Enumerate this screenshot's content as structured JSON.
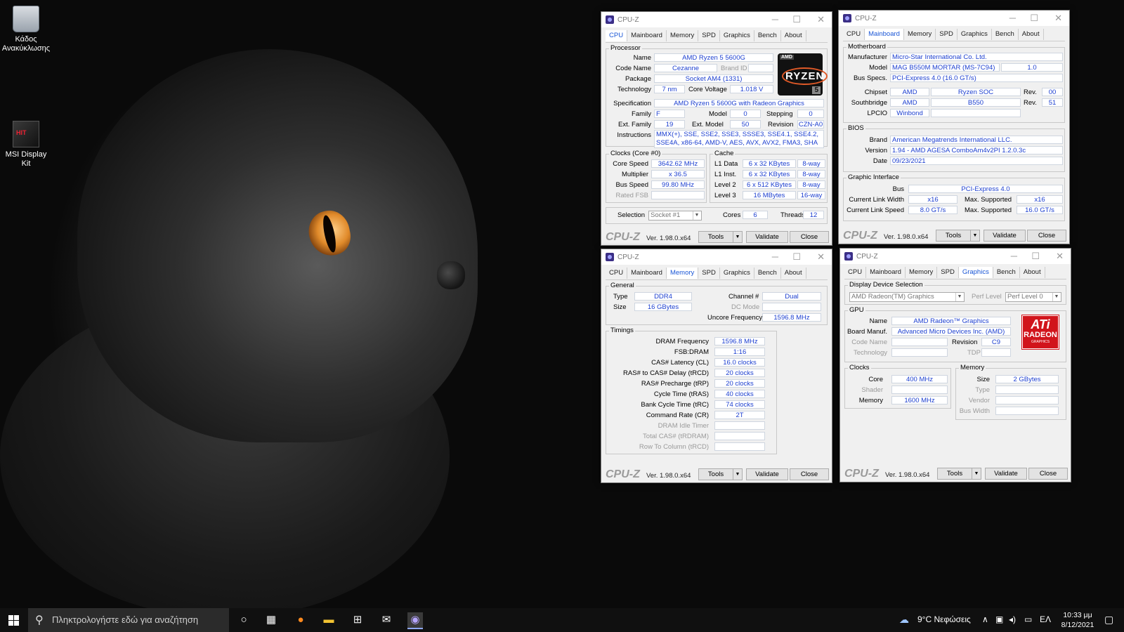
{
  "desktop": {
    "icons": [
      {
        "label": "Κάδος Ανακύκλωσης"
      },
      {
        "label": "MSI Display Kit",
        "badge": "HIT"
      }
    ]
  },
  "taskbar": {
    "search_placeholder": "Πληκτρολογήστε εδώ για αναζήτηση",
    "weather": "9°C  Νεφώσεις",
    "lang": "ΕΛ",
    "time": "10:33 μμ",
    "date": "8/12/2021"
  },
  "common": {
    "app_title": "CPU-Z",
    "tabs": [
      "CPU",
      "Mainboard",
      "Memory",
      "SPD",
      "Graphics",
      "Bench",
      "About"
    ],
    "brand": "CPU-Z",
    "version": "Ver. 1.98.0.x64",
    "tools": "Tools",
    "validate": "Validate",
    "close": "Close",
    "dropdown_arrow": "▼"
  },
  "cpu": {
    "processor_group": "Processor",
    "name_label": "Name",
    "name": "AMD Ryzen 5 5600G",
    "codename_label": "Code Name",
    "codename": "Cezanne",
    "brandid_label": "Brand ID",
    "package_label": "Package",
    "package": "Socket AM4 (1331)",
    "technology_label": "Technology",
    "technology": "7 nm",
    "corevoltage_label": "Core Voltage",
    "corevoltage": "1.018 V",
    "spec_label": "Specification",
    "spec": "AMD Ryzen 5 5600G with Radeon Graphics",
    "family_label": "Family",
    "family": "F",
    "model_label": "Model",
    "model": "0",
    "stepping_label": "Stepping",
    "stepping": "0",
    "extfamily_label": "Ext. Family",
    "extfamily": "19",
    "extmodel_label": "Ext. Model",
    "extmodel": "50",
    "revision_label": "Revision",
    "revision": "CZN-A0",
    "instructions_label": "Instructions",
    "instructions": "MMX(+), SSE, SSE2, SSE3, SSSE3, SSE4.1, SSE4.2, SSE4A, x86-64, AMD-V, AES, AVX, AVX2, FMA3, SHA",
    "clocks_group": "Clocks (Core #0)",
    "corespeed_label": "Core Speed",
    "corespeed": "3642.62 MHz",
    "multiplier_label": "Multiplier",
    "multiplier": "x 36.5",
    "busspeed_label": "Bus Speed",
    "busspeed": "99.80 MHz",
    "ratedfsb_label": "Rated FSB",
    "cache_group": "Cache",
    "l1d_label": "L1 Data",
    "l1d": "6 x 32 KBytes",
    "l1d_way": "8-way",
    "l1i_label": "L1 Inst.",
    "l1i": "6 x 32 KBytes",
    "l1i_way": "8-way",
    "l2_label": "Level 2",
    "l2": "6 x 512 KBytes",
    "l2_way": "8-way",
    "l3_label": "Level 3",
    "l3": "16 MBytes",
    "l3_way": "16-way",
    "selection_label": "Selection",
    "selection": "Socket #1",
    "cores_label": "Cores",
    "cores": "6",
    "threads_label": "Threads",
    "threads": "12",
    "logo_amd": "AMD",
    "logo_ryzen": "RYZEN",
    "logo_num": "5"
  },
  "mainboard": {
    "motherboard_group": "Motherboard",
    "manufacturer_label": "Manufacturer",
    "manufacturer": "Micro-Star International Co. Ltd.",
    "model_label": "Model",
    "model": "MAG B550M MORTAR (MS-7C94)",
    "model_rev": "1.0",
    "busspecs_label": "Bus Specs.",
    "busspecs": "PCI-Express 4.0 (16.0 GT/s)",
    "chipset_label": "Chipset",
    "chipset_vendor": "AMD",
    "chipset_name": "Ryzen SOC",
    "rev_label": "Rev.",
    "chipset_rev": "00",
    "southbridge_label": "Southbridge",
    "sb_vendor": "AMD",
    "sb_name": "B550",
    "sb_rev": "51",
    "lpcio_label": "LPCIO",
    "lpcio": "Winbond",
    "bios_group": "BIOS",
    "brand_label": "Brand",
    "brand": "American Megatrends International LLC.",
    "version_label": "Version",
    "version": "1.94 - AMD AGESA ComboAm4v2PI 1.2.0.3c",
    "date_label": "Date",
    "date": "09/23/2021",
    "gi_group": "Graphic Interface",
    "bus_label": "Bus",
    "bus": "PCI-Express 4.0",
    "clw_label": "Current Link Width",
    "clw": "x16",
    "maxsup_label": "Max. Supported",
    "mlw": "x16",
    "cls_label": "Current Link Speed",
    "cls": "8.0 GT/s",
    "mls": "16.0 GT/s"
  },
  "memory": {
    "general_group": "General",
    "type_label": "Type",
    "type": "DDR4",
    "size_label": "Size",
    "size": "16 GBytes",
    "channel_label": "Channel #",
    "channel": "Dual",
    "dcmode_label": "DC Mode",
    "uncore_label": "Uncore Frequency",
    "uncore": "1596.8 MHz",
    "timings_group": "Timings",
    "timings": [
      {
        "label": "DRAM Frequency",
        "value": "1596.8 MHz",
        "dim": false
      },
      {
        "label": "FSB:DRAM",
        "value": "1:16",
        "dim": false
      },
      {
        "label": "CAS# Latency (CL)",
        "value": "16.0 clocks",
        "dim": false
      },
      {
        "label": "RAS# to CAS# Delay (tRCD)",
        "value": "20 clocks",
        "dim": false
      },
      {
        "label": "RAS# Precharge (tRP)",
        "value": "20 clocks",
        "dim": false
      },
      {
        "label": "Cycle Time (tRAS)",
        "value": "40 clocks",
        "dim": false
      },
      {
        "label": "Bank Cycle Time (tRC)",
        "value": "74 clocks",
        "dim": false
      },
      {
        "label": "Command Rate (CR)",
        "value": "2T",
        "dim": false
      },
      {
        "label": "DRAM Idle Timer",
        "value": "",
        "dim": true
      },
      {
        "label": "Total CAS# (tRDRAM)",
        "value": "",
        "dim": true
      },
      {
        "label": "Row To Column (tRCD)",
        "value": "",
        "dim": true
      }
    ]
  },
  "graphics": {
    "dds_group": "Display Device Selection",
    "device": "AMD Radeon(TM) Graphics",
    "perflevel_label": "Perf Level",
    "perflevel": "Perf Level 0",
    "gpu_group": "GPU",
    "name_label": "Name",
    "name": "AMD Radeon™ Graphics",
    "boardmanuf_label": "Board Manuf.",
    "boardmanuf": "Advanced Micro Devices Inc. (AMD)",
    "codename_label": "Code Name",
    "revision_label": "Revision",
    "revision": "C9",
    "technology_label": "Technology",
    "tdp_label": "TDP",
    "clocks_group": "Clocks",
    "core_label": "Core",
    "core": "400 MHz",
    "shader_label": "Shader",
    "memclk_label": "Memory",
    "memclk": "1600 MHz",
    "memory_group": "Memory",
    "size_label": "Size",
    "size": "2 GBytes",
    "type_label": "Type",
    "vendor_label": "Vendor",
    "buswidth_label": "Bus Width",
    "logo_ati": "ATi",
    "logo_radeon": "RADEON",
    "logo_graphics": "GRAPHICS"
  }
}
